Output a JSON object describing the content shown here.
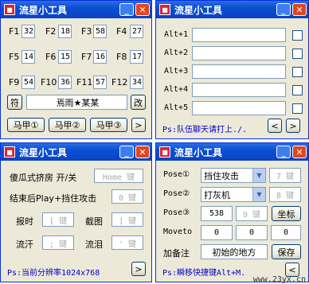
{
  "w1": {
    "title": "流星小工具",
    "fkeys": [
      {
        "label": "F1",
        "value": "32"
      },
      {
        "label": "F2",
        "value": "18"
      },
      {
        "label": "F3",
        "value": "58"
      },
      {
        "label": "F4",
        "value": "27"
      },
      {
        "label": "F5",
        "value": "14"
      },
      {
        "label": "F6",
        "value": "15"
      },
      {
        "label": "F7",
        "value": "16"
      },
      {
        "label": "F8",
        "value": "17"
      },
      {
        "label": "F9",
        "value": "54"
      },
      {
        "label": "F10",
        "value": "36"
      },
      {
        "label": "F11",
        "value": "57"
      },
      {
        "label": "F12",
        "value": "34"
      }
    ],
    "fu_label": "符",
    "name_value": "焉雨★某某",
    "gai_label": "改",
    "buttons": [
      "马甲①",
      "马甲②",
      "马甲③"
    ],
    "next": ">"
  },
  "w2": {
    "title": "流星小工具",
    "alts": [
      "Alt+1",
      "Alt+2",
      "Alt+3",
      "Alt+4",
      "Alt+5"
    ],
    "status": "Ps:队伍聊天请打上./.",
    "prev": "<",
    "next": ">"
  },
  "w3": {
    "title": "流星小工具",
    "row1_label": "傻瓜式挤房 开/关",
    "row1_key": "Home 键",
    "row2_label": "结束后Play+挡住攻击",
    "row2_key": "0 键",
    "baoshi": "报时",
    "baoshi_key": "[ 键",
    "jietu": "截图",
    "jietu_key": "] 键",
    "liuhan": "流汗",
    "liuhan_key": "; 键",
    "liulei": "流泪",
    "liulei_key": "' 键",
    "status": "Ps:当前分辨率1024x768",
    "next": ">"
  },
  "w4": {
    "title": "流星小工具",
    "pose1": "Pose①",
    "pose1_combo": "挡住攻击",
    "pose1_key": "7 键",
    "pose2": "Pose②",
    "pose2_combo": "打灰机",
    "pose2_key": "8 键",
    "pose3": "Pose③",
    "pose3_value": "538",
    "pose3_key": "9 键",
    "coord_btn": "坐标",
    "moveto": "Moveto",
    "moveto_values": [
      "0",
      "0",
      "0"
    ],
    "note_label": "加备注",
    "note_value": "初始的地方",
    "save_btn": "保存",
    "status": "Ps:瞬移快捷键Alt+M.",
    "prev": "<",
    "watermark": "www.23yx.cn"
  }
}
